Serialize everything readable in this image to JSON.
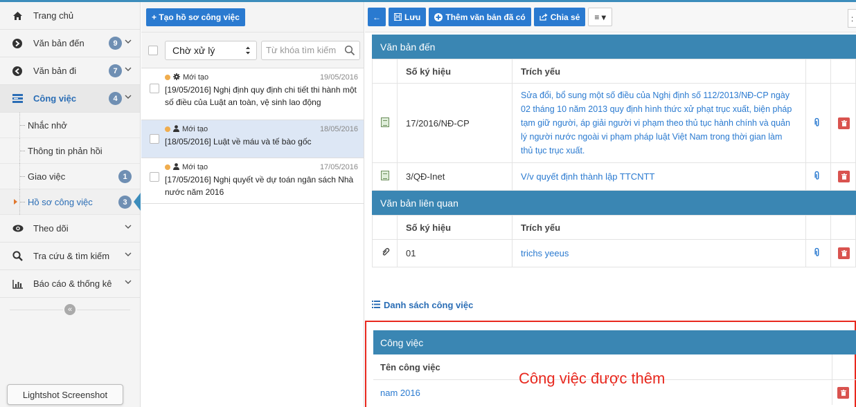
{
  "sidebar": {
    "items": [
      {
        "label": "Trang chủ",
        "icon": "home-icon"
      },
      {
        "label": "Văn bản đến",
        "icon": "arrow-circle-right-icon",
        "badge": "9"
      },
      {
        "label": "Văn bản đi",
        "icon": "arrow-circle-left-icon",
        "badge": "7"
      },
      {
        "label": "Công việc",
        "icon": "tasks-icon",
        "badge": "4"
      }
    ],
    "sub_items": [
      {
        "label": "Nhắc nhở"
      },
      {
        "label": "Thông tin phản hồi"
      },
      {
        "label": "Giao việc",
        "badge": "1"
      },
      {
        "label": "Hồ sơ công việc",
        "badge": "3"
      }
    ],
    "more_items": [
      {
        "label": "Theo dõi",
        "icon": "eye-icon"
      },
      {
        "label": "Tra cứu & tìm kiếm",
        "icon": "search-icon"
      },
      {
        "label": "Báo cáo & thống kê",
        "icon": "bar-chart-icon"
      }
    ],
    "collapse_glyph": "«",
    "lightshot_label": "Lightshot Screenshot"
  },
  "middle": {
    "create_button": "+ Tạo hồ sơ công việc",
    "filter_select": "Chờ xử lý",
    "search_placeholder": "Từ khóa tìm kiếm",
    "tasks": [
      {
        "status": "Mới tạo",
        "icon": "gear-icon",
        "date": "19/05/2016",
        "title": "[19/05/2016] Nghị định quy định chi tiết thi hành một số điều của Luật an toàn, vệ sinh lao động"
      },
      {
        "status": "Mới tạo",
        "icon": "user-icon",
        "date": "18/05/2016",
        "title": "[18/05/2016] Luật về máu và tế bào gốc"
      },
      {
        "status": "Mới tạo",
        "icon": "user-icon",
        "date": "17/05/2016",
        "title": "[17/05/2016] Nghị quyết về dự toán ngân sách Nhà nước năm 2016"
      }
    ]
  },
  "toolbar": {
    "back_glyph": "←",
    "save_label": "Lưu",
    "add_doc_label": "Thêm văn bản đã có",
    "share_label": "Chia sẻ",
    "menu_glyph": "≡ ▾",
    "overflow_glyph": ":"
  },
  "incoming_docs": {
    "title": "Văn bản đến",
    "col_number": "Số ký hiệu",
    "col_summary": "Trích yếu",
    "rows": [
      {
        "number": "17/2016/NĐ-CP",
        "summary": "Sửa đổi, bổ sung một số điều của Nghị định số 112/2013/NĐ-CP ngày 02 tháng 10 năm 2013 quy định hình thức xử phạt trục xuất, biện pháp tạm giữ người, áp giải người vi phạm theo thủ tục hành chính và quản lý người nước ngoài vi phạm pháp luật Việt Nam trong thời gian làm thủ tục trục xuất."
      },
      {
        "number": "3/QĐ-Inet",
        "summary": "V/v quyết định thành lập TTCNTT"
      }
    ]
  },
  "related_docs": {
    "title": "Văn bản liên quan",
    "col_number": "Số ký hiệu",
    "col_summary": "Trích yếu",
    "rows": [
      {
        "number": "01",
        "summary": "trichs yeeus"
      }
    ]
  },
  "task_list": {
    "title": "Danh sách công việc",
    "section_title": "Công việc",
    "col_name": "Tên công việc",
    "rows": [
      {
        "name": "nam 2016"
      }
    ]
  },
  "annotation": "Công việc được thêm",
  "colors": {
    "primary": "#2a7ad0",
    "section_header": "#3a86b3",
    "danger": "#d9534f",
    "annotation": "#e8281e",
    "badge": "#6f8fb3"
  }
}
